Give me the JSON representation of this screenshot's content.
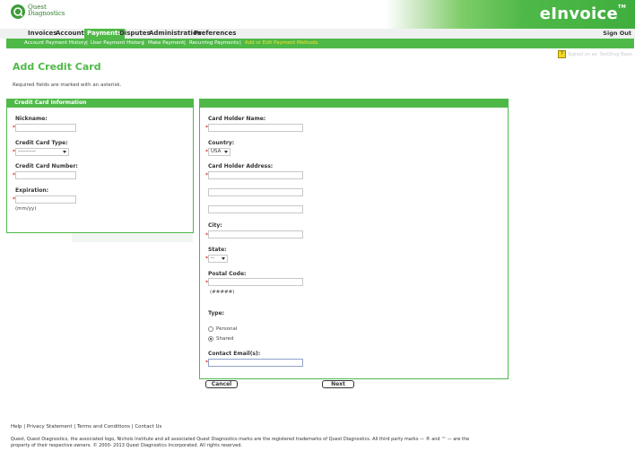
{
  "header": {
    "logo_line1": "Quest",
    "logo_line2": "Diagnostics",
    "brand": "eInvoice",
    "tm": "TM"
  },
  "nav": {
    "items": [
      {
        "label": "Invoices"
      },
      {
        "label": "Accounts"
      },
      {
        "label": "Payments"
      },
      {
        "label": "Disputes"
      },
      {
        "label": "Administration"
      },
      {
        "label": "Preferences"
      }
    ],
    "sign_out": "Sign Out"
  },
  "subnav": {
    "items": [
      {
        "label": "Account Payment History"
      },
      {
        "label": "User Payment History"
      },
      {
        "label": "Make Payment"
      },
      {
        "label": "Recurring Payments"
      },
      {
        "label": "Add or Edit Payment Methods"
      }
    ],
    "separator": "|"
  },
  "signed_in": {
    "badge": "?",
    "text": "Signed on as: TestDrug Basic"
  },
  "page": {
    "title": "Add Credit Card",
    "required_note": "Required fields are marked with an asterisk."
  },
  "left_panel": {
    "title": "Credit Card Information",
    "nickname_label": "Nickname:",
    "card_type_label": "Credit Card Type:",
    "card_type_value": "----------",
    "card_number_label": "Credit Card Number:",
    "expiration_label": "Expiration:",
    "expiration_hint": "(mm/yy)"
  },
  "right_panel": {
    "holder_name_label": "Card Holder Name:",
    "country_label": "Country:",
    "country_value": "USA",
    "address_label": "Card Holder Address:",
    "city_label": "City:",
    "state_label": "State:",
    "state_value": "--",
    "postal_label": "Postal Code:",
    "postal_hint": "(#####)",
    "type_label": "Type:",
    "type_personal": "Personal",
    "type_shared": "Shared",
    "email_label": "Contact Email(s):"
  },
  "buttons": {
    "cancel": "Cancel",
    "next": "Next"
  },
  "required_star": "*",
  "footer": {
    "links": "Help | Privacy Statement | Terms and Conditions | Contact Us",
    "legal": "Quest, Quest Diagnostics, the associated logo, Nichols Institute and all associated Quest Diagnostics marks are the registered trademarks of Quest Diagnostics. All third party marks — ® and ™ — are the property of their respective owners. © 2000- 2013 Quest Diagnostics Incorporated. All rights reserved."
  },
  "colors": {
    "brand_green": "#4fb948",
    "link_yellow": "#f3e12a"
  }
}
